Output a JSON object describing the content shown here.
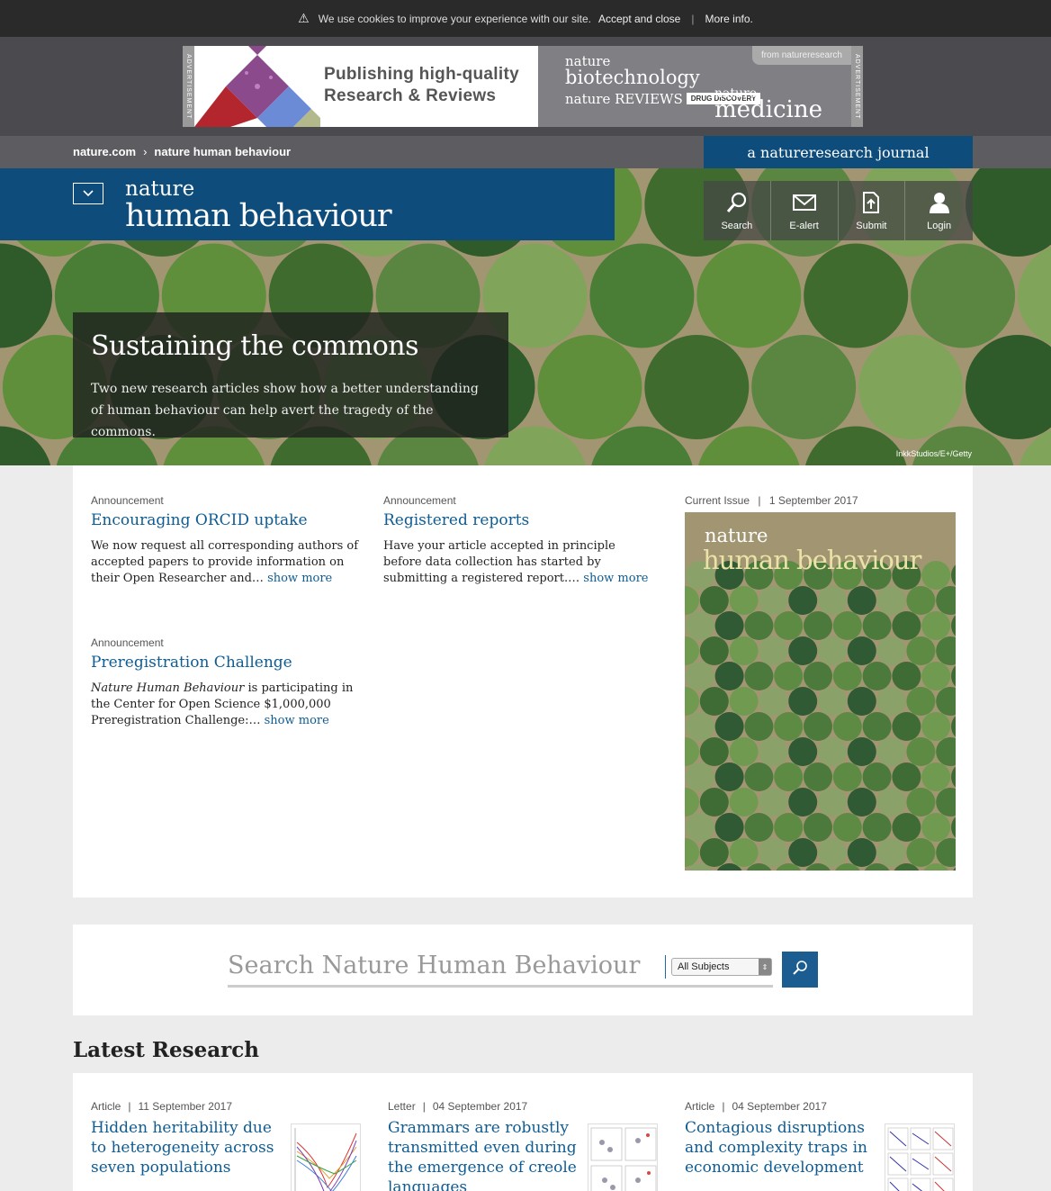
{
  "cookie": {
    "message": "We use cookies to improve your experience with our site.",
    "accept": "Accept and close",
    "separator": "|",
    "more": "More info."
  },
  "ad": {
    "label": "ADVERTISEMENT",
    "headline_line1": "Publishing high-quality",
    "headline_line2": "Research & Reviews",
    "from": "from natureresearch",
    "brand1_small": "nature",
    "brand1_big": "biotechnology",
    "brand2_text": "nature REVIEWS",
    "brand2_box": "DRUG DISCOVERY",
    "brand3_small": "nature",
    "brand3_big": "medicine"
  },
  "breadcrumb": {
    "home": "nature.com",
    "current": "nature human behaviour"
  },
  "tagline": "a natureresearch journal",
  "logo": {
    "line1": "nature",
    "line2": "human behaviour"
  },
  "tools": [
    {
      "label": "Search",
      "icon": "search-icon"
    },
    {
      "label": "E-alert",
      "icon": "envelope-icon"
    },
    {
      "label": "Submit",
      "icon": "upload-icon"
    },
    {
      "label": "Login",
      "icon": "user-icon"
    }
  ],
  "hero": {
    "title": "Sustaining the commons",
    "text": "Two new research articles show how a better understanding of human behaviour can help avert the tragedy of the commons.",
    "credit": "InkkStudios/E+/Getty"
  },
  "announcements": [
    {
      "kicker": "Announcement",
      "title": "Encouraging ORCID uptake",
      "text": "We now request all corresponding authors of accepted papers to provide information on their Open Researcher and…",
      "more": "show more"
    },
    {
      "kicker": "Announcement",
      "title": "Registered reports",
      "text": "Have your article accepted in principle before data collection has started by submitting a registered report.…",
      "more": "show more"
    },
    {
      "kicker": "Announcement",
      "title": "Preregistration Challenge",
      "text_italic": "Nature Human Behaviour",
      "text": " is participating in the Center for Open Science $1,000,000 Preregistration Challenge:…",
      "more": "show more"
    }
  ],
  "current_issue": {
    "label": "Current Issue",
    "separator": "|",
    "date": "1 September 2017",
    "cover_line1": "nature",
    "cover_line2": "human behaviour"
  },
  "search": {
    "placeholder": "Search Nature Human Behaviour",
    "select_value": "All Subjects"
  },
  "latest": {
    "heading": "Latest Research",
    "cards": [
      {
        "type": "Article",
        "date": "11 September 2017",
        "title": "Hidden heritability due to heterogeneity across seven populations"
      },
      {
        "type": "Letter",
        "date": "04 September 2017",
        "title": "Grammars are robustly transmitted even during the emergence of creole languages"
      },
      {
        "type": "Article",
        "date": "04 September 2017",
        "title": "Contagious disruptions and complexity traps in economic development"
      }
    ]
  },
  "colors": {
    "brand_blue": "#0e4c7c",
    "link_blue": "#0e5c93",
    "cookie_bg": "#2a2a2a"
  }
}
